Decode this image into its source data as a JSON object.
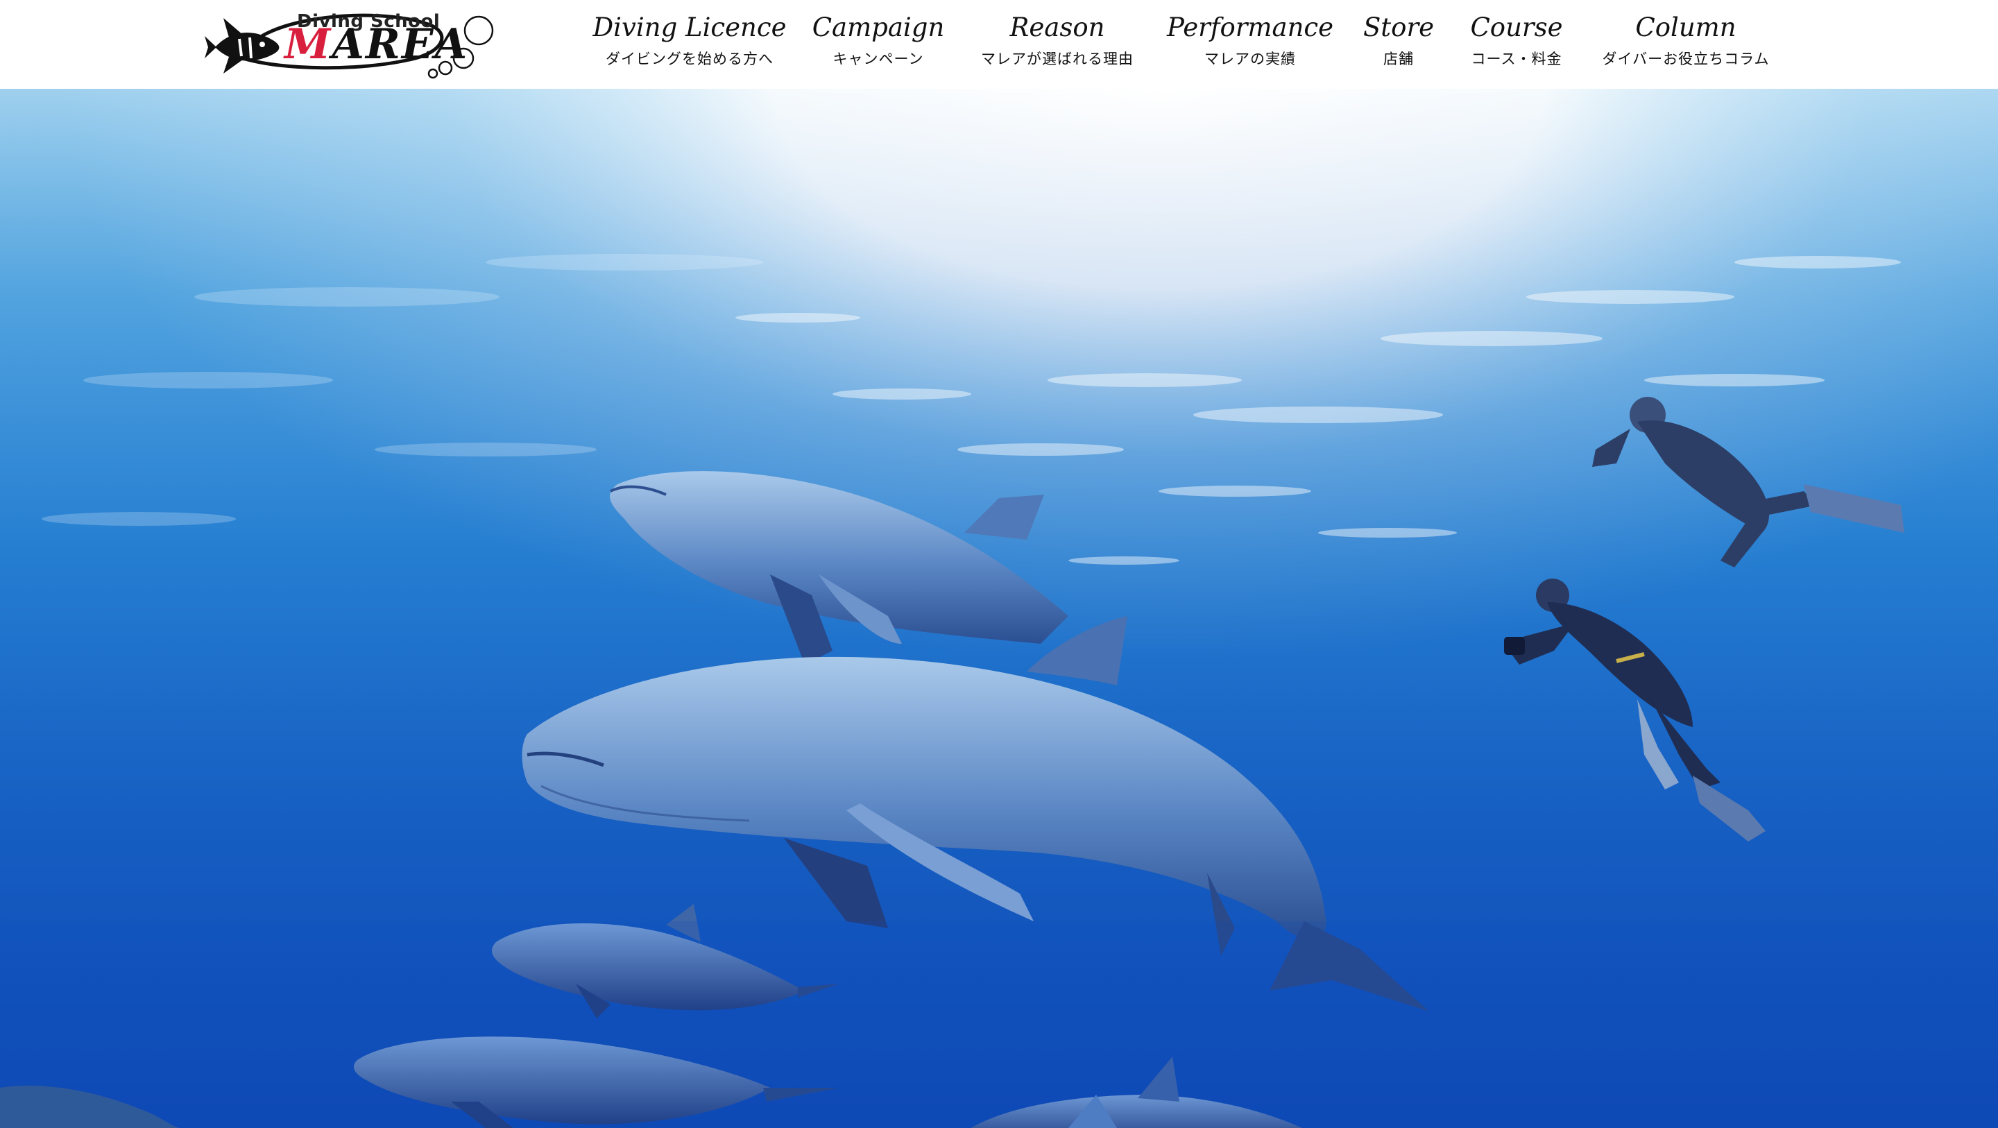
{
  "logo": {
    "tagline": "Diving School",
    "brand_prefix": "M",
    "brand_rest": "AREA"
  },
  "nav": {
    "items": [
      {
        "en": "Diving Licence",
        "ja": "ダイビングを始める方へ"
      },
      {
        "en": "Campaign",
        "ja": "キャンペーン"
      },
      {
        "en": "Reason",
        "ja": "マレアが選ばれる理由"
      },
      {
        "en": "Performance",
        "ja": "マレアの実績"
      },
      {
        "en": "Store",
        "ja": "店舗"
      },
      {
        "en": "Course",
        "ja": "コース・料金"
      },
      {
        "en": "Column",
        "ja": "ダイバーお役立ちコラム"
      }
    ]
  },
  "colors": {
    "brand_accent": "#d81f3d",
    "header_bg": "#ffffff",
    "text": "#111111"
  },
  "icons": {
    "logo_mark": "angelfish-logo-icon",
    "bubbles": "bubbles-icon"
  }
}
